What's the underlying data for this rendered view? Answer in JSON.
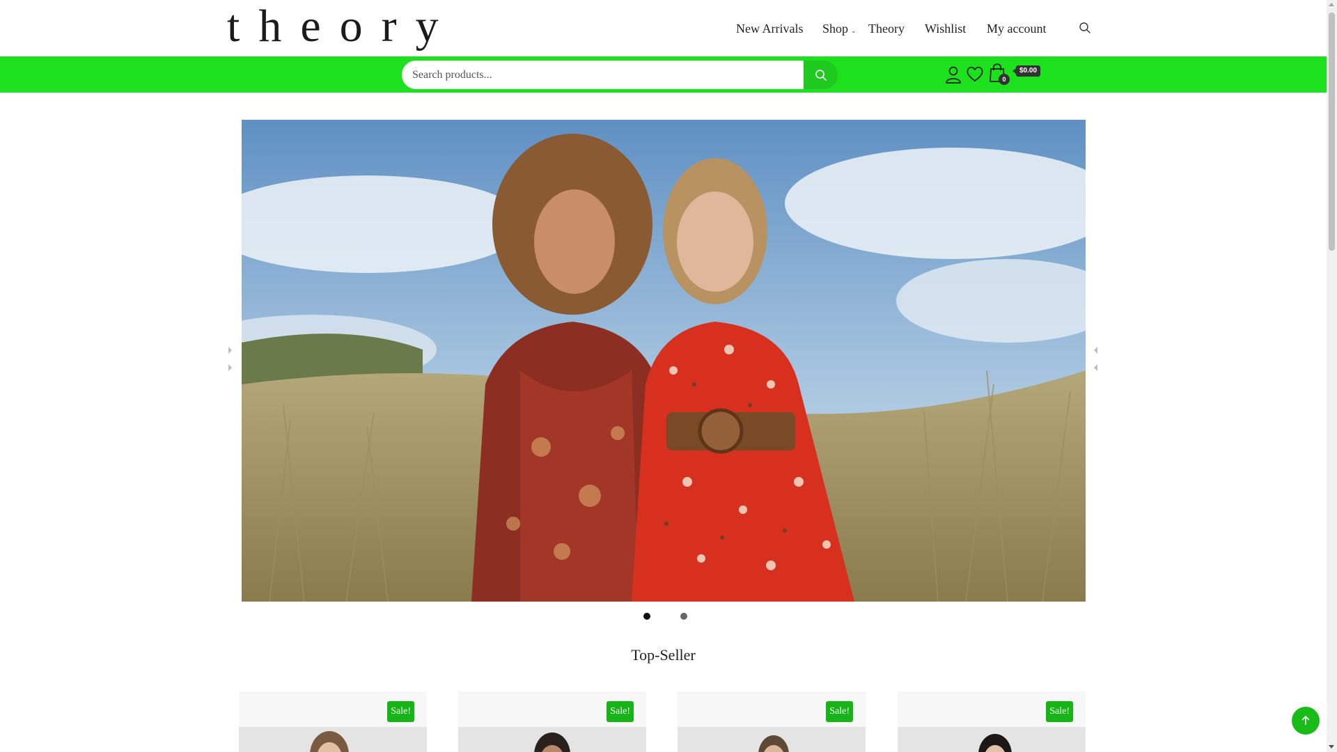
{
  "brand": {
    "logo_text": "theory"
  },
  "nav": {
    "items": [
      {
        "label": "New Arrivals"
      },
      {
        "label": "Shop",
        "has_dropdown": true
      },
      {
        "label": "Theory"
      },
      {
        "label": "Wishlist"
      },
      {
        "label": "My account"
      }
    ],
    "search_icon": "search-icon"
  },
  "search": {
    "placeholder": "Search products...",
    "button_icon": "search-icon"
  },
  "header_icons": {
    "account": "user-icon",
    "wishlist": "heart-icon",
    "cart": "shopping-bag-icon"
  },
  "cart": {
    "count": "0",
    "total": "$0.00"
  },
  "hero": {
    "slides_count": 2,
    "active_slide": 1,
    "image": "two-women-in-red-floral-dresses-in-dune-grass"
  },
  "top_seller": {
    "title": "Top-Seller",
    "products": [
      {
        "badge": "Sale!"
      },
      {
        "badge": "Sale!"
      },
      {
        "badge": "Sale!"
      },
      {
        "badge": "Sale!"
      }
    ]
  },
  "colors": {
    "accent_green": "#1ee11e",
    "button_green": "#19bb19",
    "text": "#222222"
  },
  "back_to_top_icon": "arrow-up-icon"
}
